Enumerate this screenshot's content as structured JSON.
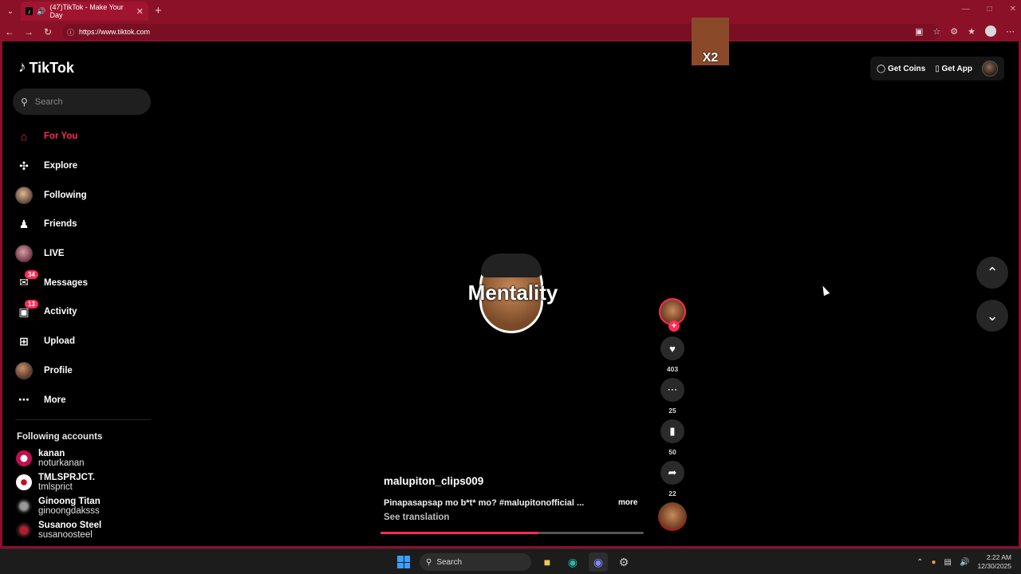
{
  "browser": {
    "tab_title": "(47)TikTok - Make Your Day",
    "url": "https://www.tiktok.com",
    "accent": "#8a1128"
  },
  "tiktok": {
    "logo_text": "TikTok",
    "search_placeholder": "Search",
    "nav": [
      {
        "label": "For You",
        "icon": "home-icon"
      },
      {
        "label": "Explore",
        "icon": "compass-icon"
      },
      {
        "label": "Following",
        "icon": "following-avatar"
      },
      {
        "label": "Friends",
        "icon": "friends-icon"
      },
      {
        "label": "LIVE",
        "icon": "live-avatar"
      },
      {
        "label": "Messages",
        "icon": "messages-icon",
        "badge": "34"
      },
      {
        "label": "Activity",
        "icon": "activity-icon",
        "badge": "13"
      },
      {
        "label": "Upload",
        "icon": "upload-icon"
      },
      {
        "label": "Profile",
        "icon": "profile-avatar"
      },
      {
        "label": "More",
        "icon": "more-icon"
      }
    ],
    "following_accounts_title": "Following accounts",
    "following_accounts": [
      {
        "name": "kanan",
        "handle": "noturkanan"
      },
      {
        "name": "TMLSPRJCT.",
        "handle": "tmlsprict"
      },
      {
        "name": "Ginoong Titan",
        "handle": "ginoongdaksss"
      },
      {
        "name": "Susanoo Steel",
        "handle": "susanoosteel"
      }
    ],
    "get_coins": "Get Coins",
    "get_app": "Get App",
    "sticker_text": "X2"
  },
  "video": {
    "logo_text": "Mentality",
    "author": "malupiton_clips009",
    "caption": "Pinapasapsap mo b*t* mo? #malupitonofficial ...",
    "more": "more",
    "see_translation": "See translation",
    "progress": 0.6,
    "likes": "403",
    "comments": "25",
    "saves": "50",
    "shares": "22"
  },
  "taskbar": {
    "search": "Search",
    "time": "2:22 AM",
    "date": "12/30/2025"
  }
}
